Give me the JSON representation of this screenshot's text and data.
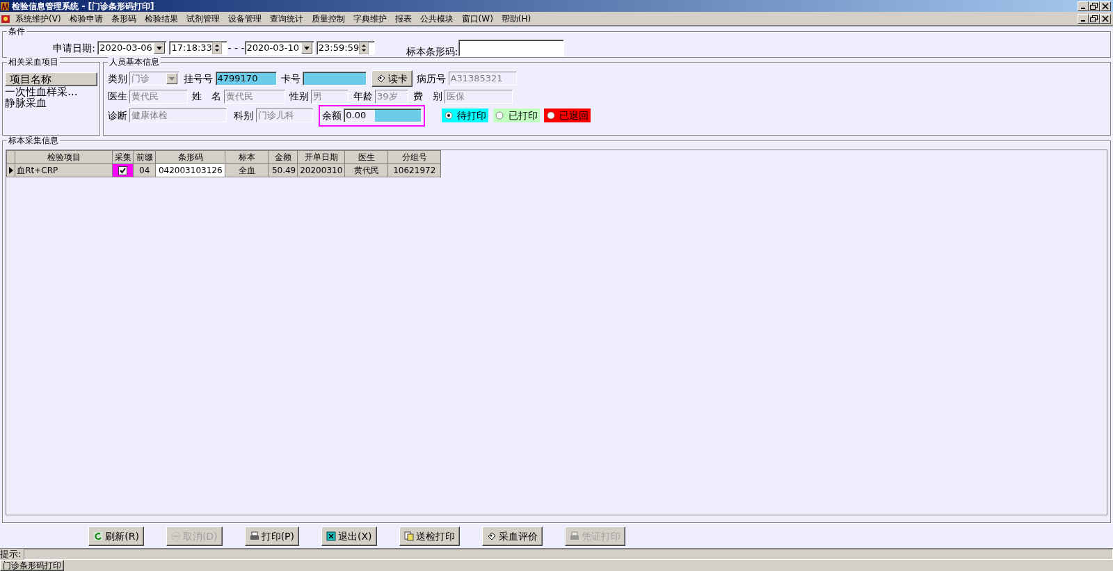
{
  "window": {
    "title": "检验信息管理系统 - [门诊条形码打印]"
  },
  "menu": [
    "系统维护(V)",
    "检验申请",
    "条形码",
    "检验结果",
    "试剂管理",
    "设备管理",
    "查询统计",
    "质量控制",
    "字典维护",
    "报表",
    "公共模块",
    "窗口(W)",
    "帮助(H)"
  ],
  "conditions": {
    "legend": "条件",
    "date_label": "申请日期:",
    "start_date": "2020-03-06",
    "start_time": "17:18:33",
    "separator": "- - -",
    "end_date": "2020-03-10",
    "end_time": "23:59:59",
    "barcode_label": "标本条形码:"
  },
  "items_panel": {
    "legend": "相关采血项目",
    "header": "项目名称",
    "items": [
      "一次性血样采...",
      "静脉采血"
    ]
  },
  "person": {
    "legend": "人员基本信息",
    "fields": [
      {
        "label": "类别",
        "value": "门诊",
        "kind": "select"
      },
      {
        "label": "挂号号",
        "value": "4799170",
        "kind": "active"
      },
      {
        "label": "卡号",
        "kind": "active"
      },
      {
        "label": "读卡",
        "kind": "button"
      },
      {
        "label": "病历号",
        "value": "A31385321",
        "kind": "readonly"
      },
      {
        "label": "医生",
        "value": "黄代民",
        "kind": "readonly"
      },
      {
        "label": "姓　名",
        "value": "黄代民",
        "kind": "readonly"
      },
      {
        "label": "性别",
        "value": "男",
        "kind": "readonly"
      },
      {
        "label": "年龄",
        "value": "39岁",
        "kind": "readonly"
      },
      {
        "label": "费　别",
        "value": "医保",
        "kind": "readonly"
      },
      {
        "label": "诊断",
        "value": "健康体检",
        "kind": "readonly"
      },
      {
        "label": "科别",
        "value": "门诊儿科",
        "kind": "readonly"
      },
      {
        "label": "余额",
        "value": "0.00",
        "kind": "balance",
        "outlined": true
      }
    ],
    "status_options": [
      {
        "label": "待打印",
        "selected": true,
        "color": "#00ffff"
      },
      {
        "label": "已打印",
        "selected": false,
        "color": "#c0ffc0"
      },
      {
        "label": "已退回",
        "selected": false,
        "color": "#ff0000"
      }
    ]
  },
  "specimen": {
    "legend": "标本采集信息",
    "columns": [
      "检验项目",
      "采集",
      "前缀",
      "条形码",
      "标本",
      "金额",
      "开单日期",
      "医生",
      "分组号"
    ],
    "rows": [
      {
        "current": true,
        "item": "血Rt+CRP",
        "collected": true,
        "prefix": "04",
        "barcode": "042003103126",
        "specimen": "全血",
        "amount": "50.49",
        "order_date": "20200310",
        "doctor": "黄代民",
        "group": "10621972"
      }
    ]
  },
  "buttons": [
    {
      "label": "刷新(R)",
      "disabled": false
    },
    {
      "label": "取消(D)",
      "disabled": true
    },
    {
      "label": "打印(P)",
      "disabled": false
    },
    {
      "label": "退出(X)",
      "disabled": false
    },
    {
      "label": "送检打印",
      "disabled": false
    },
    {
      "label": "采血评价",
      "disabled": false
    },
    {
      "label": "凭证打印",
      "disabled": true
    }
  ],
  "status_bar": {
    "label": "提示:"
  },
  "taskbar": {
    "tab": "门诊条形码打印"
  }
}
